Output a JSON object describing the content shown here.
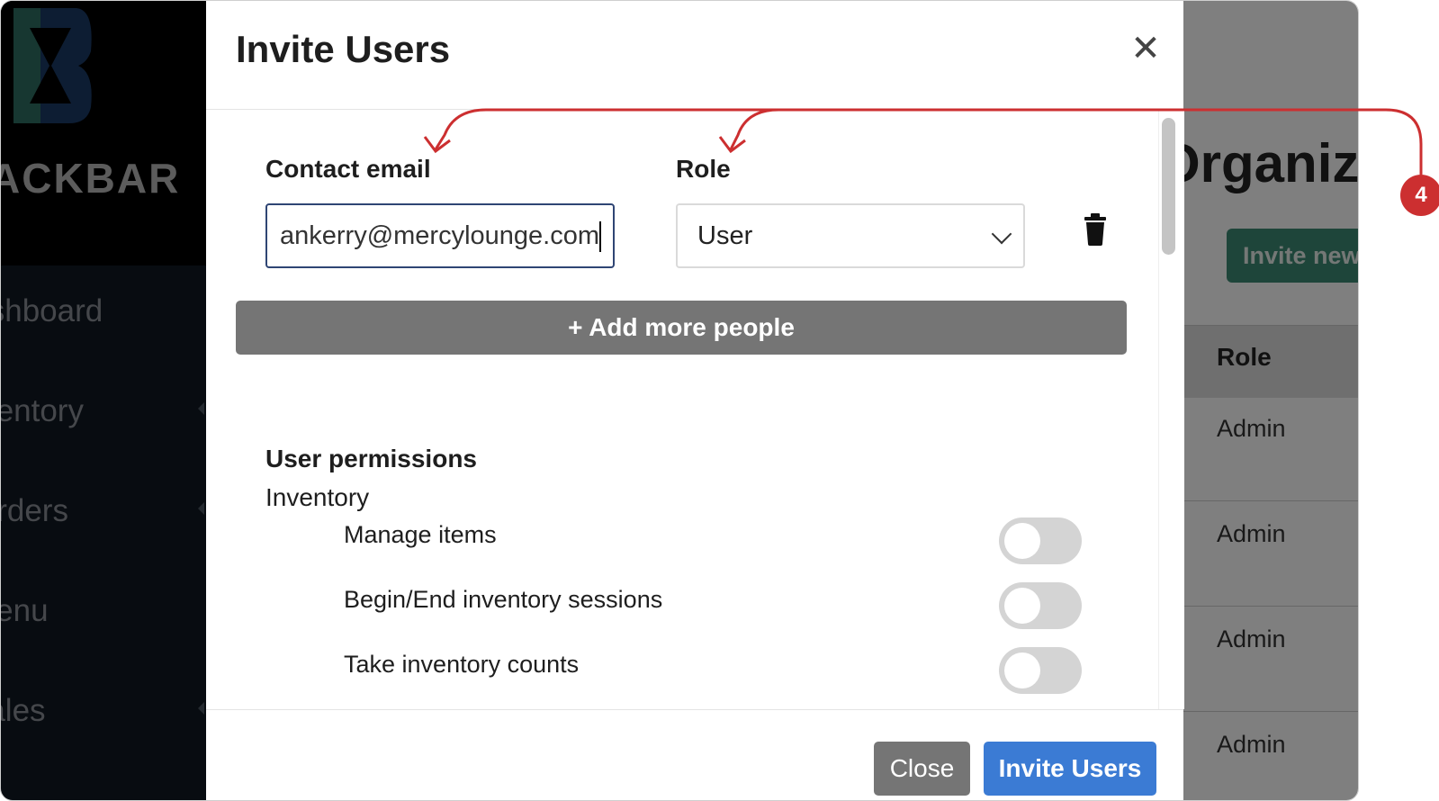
{
  "sidebar": {
    "brand": "ACKBAR",
    "items": [
      {
        "label": "Dashboard"
      },
      {
        "label": "Inventory"
      },
      {
        "label": "Orders"
      },
      {
        "label": "Menu"
      },
      {
        "label": "Sales"
      }
    ]
  },
  "page": {
    "title": "Organization",
    "invite_button": "Invite new",
    "table": {
      "role_header": "Role",
      "rows": [
        "Admin",
        "Admin",
        "Admin",
        "Admin"
      ]
    }
  },
  "modal": {
    "title": "Invite Users",
    "contact_label": "Contact email",
    "email_value": "ankerry@mercylounge.com",
    "role_label": "Role",
    "role_value": "User",
    "add_more": "+ Add more people",
    "permissions_title": "User permissions",
    "group": "Inventory",
    "permissions": [
      {
        "label": "Manage items",
        "enabled": false
      },
      {
        "label": "Begin/End inventory sessions",
        "enabled": false
      },
      {
        "label": "Take inventory counts",
        "enabled": false
      }
    ],
    "close_label": "Close",
    "invite_label": "Invite Users"
  },
  "annotation": {
    "badge": "4",
    "color": "#cc2f30"
  }
}
